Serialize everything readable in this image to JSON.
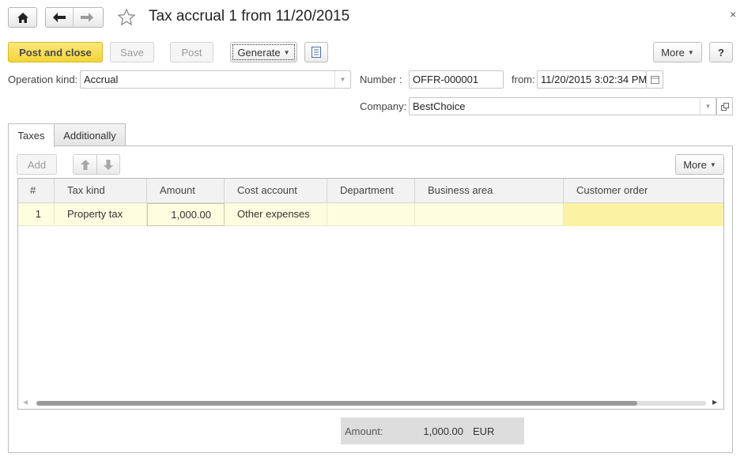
{
  "window": {
    "title": "Tax accrual 1 from 11/20/2015",
    "close_glyph": "×"
  },
  "nav": {
    "home_icon": "home-icon",
    "back_icon": "arrow-left-icon",
    "forward_icon": "arrow-right-icon",
    "favorite_icon": "star-icon"
  },
  "toolbar": {
    "post_close_label": "Post and close",
    "save_label": "Save",
    "post_label": "Post",
    "generate_label": "Generate",
    "report_icon": "document-icon",
    "more_label": "More",
    "help_label": "?"
  },
  "form": {
    "operation_kind_label": "Operation kind:",
    "operation_kind_value": "Accrual",
    "number_label": "Number :",
    "number_value": "OFFR-000001",
    "from_label": "from:",
    "from_value": "11/20/2015  3:02:34 PM",
    "company_label": "Company:",
    "company_value": "BestChoice"
  },
  "tabs": [
    {
      "label": "Taxes",
      "active": true
    },
    {
      "label": "Additionally",
      "active": false
    }
  ],
  "table_toolbar": {
    "add_label": "Add",
    "up_icon": "arrow-up-icon",
    "down_icon": "arrow-down-icon",
    "more_label": "More"
  },
  "table": {
    "columns": [
      "#",
      "Tax kind",
      "Amount",
      "Cost account",
      "Department",
      "Business area",
      "Customer order"
    ],
    "rows": [
      [
        "1",
        "Property tax",
        "1,000.00",
        "Other expenses",
        "",
        "",
        ""
      ]
    ]
  },
  "totals": {
    "amount_label": "Amount:",
    "amount_value": "1,000.00",
    "currency": "EUR"
  },
  "colors": {
    "primary_button": "#f3d537",
    "row_highlight": "#fdfde0",
    "cell_selected": "#fbf3a3"
  }
}
